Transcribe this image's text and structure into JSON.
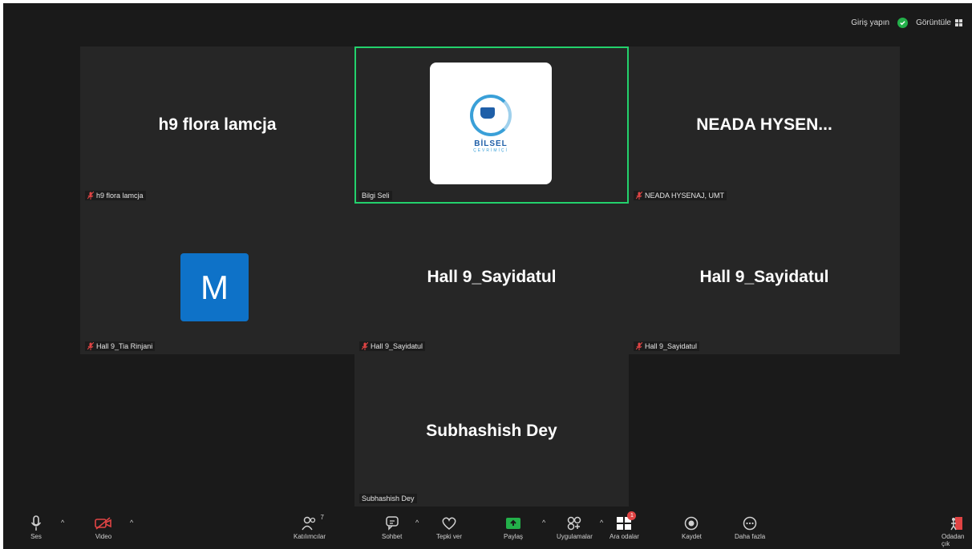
{
  "topbar": {
    "sign_in": "Giriş yapın",
    "view": "Görüntüle"
  },
  "tiles": [
    {
      "big_name": "h9 flora lamcja",
      "label": "h9 flora lamcja"
    },
    {
      "big_name": "",
      "label": "Bilgi Seli",
      "logo_text": "BİLSEL",
      "logo_sub": "ÇEVRİMİÇİ"
    },
    {
      "big_name": "NEADA HYSEN...",
      "label": "NEADA HYSENAJ, UMT"
    },
    {
      "avatar_letter": "M",
      "label": "Hall 9_Tia Rinjani"
    },
    {
      "big_name": "Hall 9_Sayidatul",
      "label": "Hall 9_Sayidatul"
    },
    {
      "big_name": "Hall 9_Sayidatul",
      "label": "Hall 9_Sayidatul"
    },
    {
      "big_name": "Subhashish Dey",
      "label": "Subhashish Dey"
    }
  ],
  "toolbar": {
    "audio": "Ses",
    "video": "Video",
    "participants": "Katılımcılar",
    "participants_count": "7",
    "chat": "Sohbet",
    "react": "Tepki ver",
    "share": "Paylaş",
    "apps": "Uygulamalar",
    "breakout": "Ara odalar",
    "breakout_badge": "1",
    "record": "Kaydet",
    "more": "Daha fazla",
    "leave": "Odadan çık"
  },
  "colors": {
    "active_border": "#23d16c",
    "share_green": "#23b04a",
    "avatar_blue": "#0e72c8",
    "mute_red": "#e04444"
  }
}
